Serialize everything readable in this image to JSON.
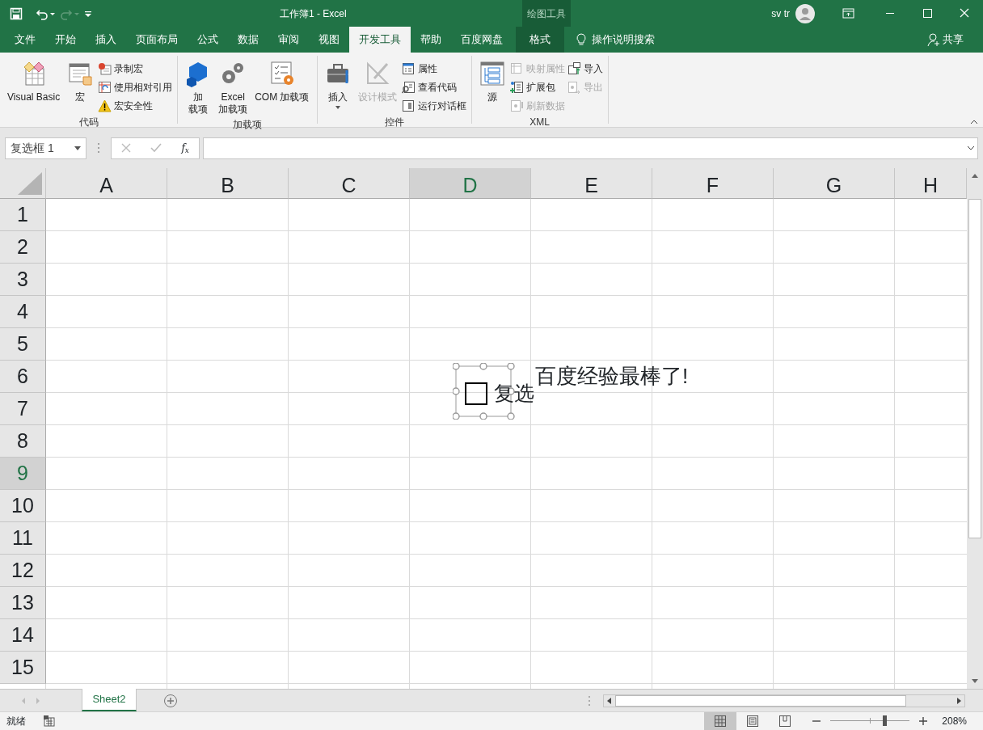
{
  "title_bar": {
    "title": "工作簿1  -  Excel",
    "context_label": "绘图工具",
    "user": "sv tr"
  },
  "tabs": [
    {
      "label": "文件",
      "selected": false,
      "contextual": false
    },
    {
      "label": "开始",
      "selected": false,
      "contextual": false
    },
    {
      "label": "插入",
      "selected": false,
      "contextual": false
    },
    {
      "label": "页面布局",
      "selected": false,
      "contextual": false
    },
    {
      "label": "公式",
      "selected": false,
      "contextual": false
    },
    {
      "label": "数据",
      "selected": false,
      "contextual": false
    },
    {
      "label": "审阅",
      "selected": false,
      "contextual": false
    },
    {
      "label": "视图",
      "selected": false,
      "contextual": false
    },
    {
      "label": "开发工具",
      "selected": true,
      "contextual": false
    },
    {
      "label": "帮助",
      "selected": false,
      "contextual": false
    },
    {
      "label": "百度网盘",
      "selected": false,
      "contextual": false
    },
    {
      "label": "格式",
      "selected": false,
      "contextual": true
    }
  ],
  "tell_me": "操作说明搜索",
  "share": "共享",
  "ribbon_groups": [
    {
      "label": "代码",
      "commands": [
        {
          "kind": "large",
          "lines": [
            "Visual Basic"
          ],
          "disabled": false
        },
        {
          "kind": "large",
          "lines": [
            "宏"
          ],
          "disabled": false
        },
        {
          "kind": "small",
          "lines": [
            "录制宏"
          ],
          "disabled": false
        },
        {
          "kind": "small",
          "lines": [
            "使用相对引用"
          ],
          "disabled": false
        },
        {
          "kind": "small",
          "lines": [
            "宏安全性"
          ],
          "disabled": false
        }
      ]
    },
    {
      "label": "加载项",
      "commands": [
        {
          "kind": "large",
          "lines": [
            "加",
            "载项"
          ],
          "disabled": false
        },
        {
          "kind": "large",
          "lines": [
            "Excel",
            "加载项"
          ],
          "disabled": false
        },
        {
          "kind": "large",
          "lines": [
            "COM 加载项"
          ],
          "disabled": false
        }
      ]
    },
    {
      "label": "控件",
      "commands": [
        {
          "kind": "large",
          "lines": [
            "插入"
          ],
          "disabled": false,
          "dropdown": true
        },
        {
          "kind": "large",
          "lines": [
            "设计模式"
          ],
          "disabled": true
        },
        {
          "kind": "small",
          "lines": [
            "属性"
          ],
          "disabled": false
        },
        {
          "kind": "small",
          "lines": [
            "查看代码"
          ],
          "disabled": false
        },
        {
          "kind": "small",
          "lines": [
            "运行对话框"
          ],
          "disabled": false
        }
      ]
    },
    {
      "label": "XML",
      "commands": [
        {
          "kind": "large",
          "lines": [
            "源"
          ],
          "disabled": false
        },
        {
          "kind": "small",
          "lines": [
            "映射属性"
          ],
          "disabled": true
        },
        {
          "kind": "small",
          "lines": [
            "扩展包"
          ],
          "disabled": false
        },
        {
          "kind": "small",
          "lines": [
            "刷新数据"
          ],
          "disabled": true
        },
        {
          "kind": "small",
          "lines": [
            "导入"
          ],
          "disabled": false
        },
        {
          "kind": "small",
          "lines": [
            "导出"
          ],
          "disabled": true
        }
      ]
    }
  ],
  "formula_bar": {
    "name_box": "复选框 1",
    "function_button": "f$_{x}$"
  },
  "columns": [
    {
      "label": "A",
      "selected": false
    },
    {
      "label": "B",
      "selected": false
    },
    {
      "label": "C",
      "selected": false
    },
    {
      "label": "D",
      "selected": true
    },
    {
      "label": "E",
      "selected": false
    },
    {
      "label": "F",
      "selected": false
    },
    {
      "label": "G",
      "selected": false
    },
    {
      "label": "H",
      "selected": false
    }
  ],
  "rows": [
    {
      "label": "1",
      "selected": false
    },
    {
      "label": "2",
      "selected": false
    },
    {
      "label": "3",
      "selected": false
    },
    {
      "label": "4",
      "selected": false
    },
    {
      "label": "5",
      "selected": false
    },
    {
      "label": "6",
      "selected": false,
      "cells": [
        null,
        null,
        null,
        null,
        "百度经验最棒了!"
      ]
    },
    {
      "label": "7",
      "selected": false
    },
    {
      "label": "8",
      "selected": false
    },
    {
      "label": "9",
      "selected": true
    },
    {
      "label": "10",
      "selected": false
    },
    {
      "label": "11",
      "selected": false
    },
    {
      "label": "12",
      "selected": false
    },
    {
      "label": "13",
      "selected": false
    },
    {
      "label": "14",
      "selected": false
    },
    {
      "label": "15",
      "selected": false
    }
  ],
  "checkbox_control": {
    "label": "复选",
    "checked": false,
    "selected": true
  },
  "sheet_tabs": [
    {
      "label": "Sheet2",
      "selected": true
    }
  ],
  "status_bar": {
    "status": "就绪",
    "views": [
      {
        "selected": true
      },
      {
        "selected": false
      },
      {
        "selected": false
      }
    ],
    "zoom": {
      "level": 0.68,
      "reading": "208%"
    }
  }
}
